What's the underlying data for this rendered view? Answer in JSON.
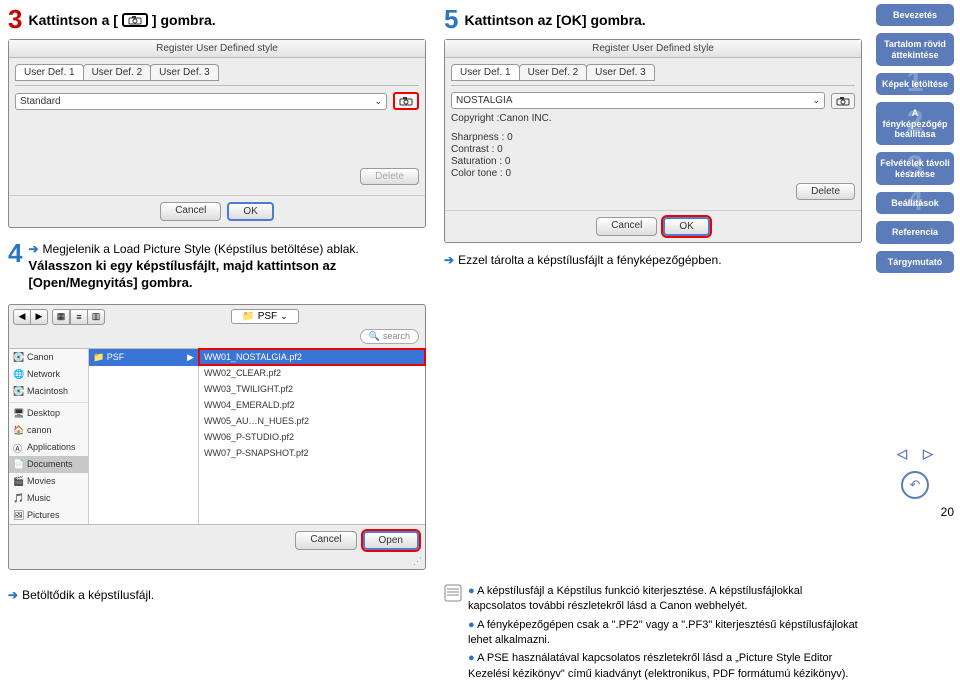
{
  "steps": {
    "s3": {
      "num": "3",
      "pre": "Kattintson a [",
      "post": "] gombra."
    },
    "s4a": {
      "num": "4",
      "line1": "Megjelenik a Load Picture Style (Képstílus betöltése) ablak.",
      "line2": "Válasszon ki egy képstílusfájlt, majd kattintson az [Open/Megnyitás] gombra."
    },
    "s4b": "Betöltődik a képstílusfájl.",
    "s5": {
      "num": "5",
      "text": "Kattintson az [OK] gombra."
    },
    "s5b": "Ezzel tárolta a képstílusfájlt a fényképezőgépben."
  },
  "dialog": {
    "title": "Register User Defined style",
    "tabs": [
      "User Def. 1",
      "User Def. 2",
      "User Def. 3"
    ],
    "stylePicker": "Standard",
    "deleteBtn": "Delete",
    "cancel": "Cancel",
    "ok": "OK",
    "nostalgia": "NOSTALGIA",
    "copyright": "Copyright :Canon INC.",
    "vals": [
      "Sharpness : 0",
      "Contrast : 0",
      "Saturation : 0",
      "Color tone : 0"
    ]
  },
  "picker": {
    "path": "PSF",
    "searchPlaceholder": "search",
    "sidebar": [
      "Canon",
      "Network",
      "Macintosh",
      "Desktop",
      "canon",
      "Applications",
      "Documents",
      "Movies",
      "Music",
      "Pictures"
    ],
    "midFolder": "PSF",
    "files": [
      "WW01_NOSTALGIA.pf2",
      "WW02_CLEAR.pf2",
      "WW03_TWILIGHT.pf2",
      "WW04_EMERALD.pf2",
      "WW05_AU…N_HUES.pf2",
      "WW06_P-STUDIO.pf2",
      "WW07_P-SNAPSHOT.pf2"
    ],
    "cancel": "Cancel",
    "open": "Open"
  },
  "notes": [
    "A képstílusfájl a Képstílus funkció kiterjesztése. A képstílusfájlokkal kapcsolatos további részletekről lásd a Canon webhelyét.",
    "A fényképezőgépen csak a \".PF2\" vagy a \".PF3\" kiterjesztésű képstílusfájlokat lehet alkalmazni.",
    "A PSE használatával kapcsolatos részletekről lásd a „Picture Style Editor Kezelési kézikönyv\" című kiadványt (elektronikus, PDF formátumú kézikönyv)."
  ],
  "nav": {
    "items": [
      {
        "label": "Bevezetés"
      },
      {
        "label": "Tartalom rövid áttekintése"
      },
      {
        "label": "Képek letöltése",
        "num": "1"
      },
      {
        "label": "A fényképezőgép beállítása",
        "num": "2"
      },
      {
        "label": "Felvételek távoli készítése",
        "num": "3"
      },
      {
        "label": "Beállítások",
        "num": "4"
      },
      {
        "label": "Referencia"
      },
      {
        "label": "Tárgymutató"
      }
    ],
    "pageNum": "20"
  }
}
